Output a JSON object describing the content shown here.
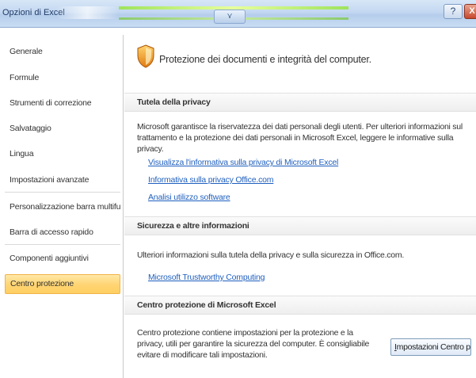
{
  "window": {
    "title": "Opzioni di Excel",
    "qat_label": "⋎",
    "help_label": "?",
    "close_label": "X"
  },
  "sidebar": {
    "items": [
      {
        "label": "Generale"
      },
      {
        "label": "Formule"
      },
      {
        "label": "Strumenti di correzione"
      },
      {
        "label": "Salvataggio"
      },
      {
        "label": "Lingua"
      },
      {
        "label": "Impostazioni avanzate"
      },
      {
        "label": "Personalizzazione barra multifunzione"
      },
      {
        "label": "Barra di accesso rapido"
      },
      {
        "label": "Componenti aggiuntivi"
      },
      {
        "label": "Centro protezione"
      }
    ],
    "active": "Centro protezione"
  },
  "main": {
    "page_title": "Protezione dei documenti e integrità del computer.",
    "privacy": {
      "header": "Tutela della privacy",
      "text": "Microsoft garantisce la riservatezza dei dati personali degli utenti. Per ulteriori informazioni sul trattamento e la protezione dei dati personali in Microsoft Excel, leggere le informative sulla privacy.",
      "links": [
        "Visualizza l'informativa sulla privacy di Microsoft Excel",
        "Informativa sulla privacy Office.com",
        "Analisi utilizzo software"
      ]
    },
    "security": {
      "header": "Sicurezza e altre informazioni",
      "text": "Ulteriori informazioni sulla tutela della privacy e sulla sicurezza in Office.com.",
      "link": "Microsoft Trustworthy Computing"
    },
    "trust_center": {
      "header": "Centro protezione di Microsoft Excel",
      "text": "Centro protezione contiene impostazioni per la protezione e la privacy, utili per garantire la sicurezza del computer. È consigliabile evitare di modificare tali impostazioni.",
      "button_first_letter": "I",
      "button_rest": "mpostazioni Centro protezione..."
    }
  },
  "colors": {
    "accent": "#ffd472",
    "link": "#1f5fbf"
  },
  "icons": [
    "shield-icon",
    "help-icon",
    "close-icon"
  ]
}
